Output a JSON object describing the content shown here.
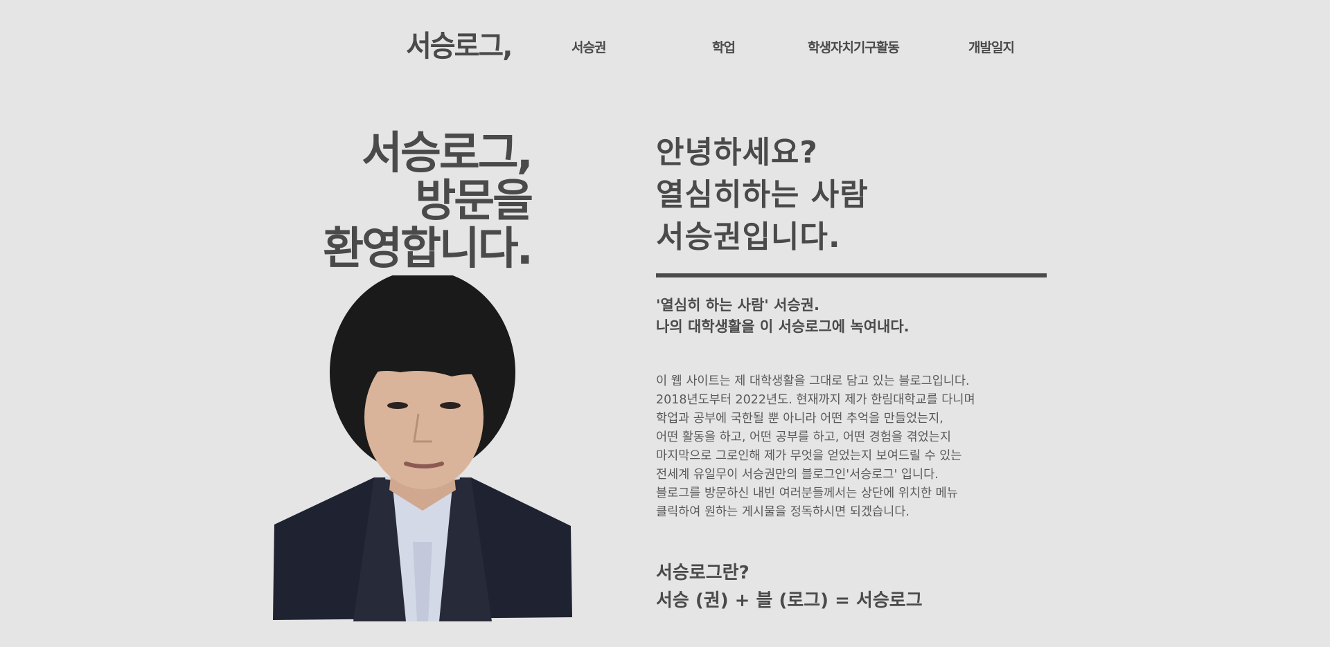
{
  "nav": {
    "logo": "서승로그,",
    "items": [
      {
        "label": "서승권"
      },
      {
        "label": "학업"
      },
      {
        "label": "학생자치기구활동"
      },
      {
        "label": "개발일지"
      }
    ]
  },
  "hero": {
    "lines": [
      "서승로그,",
      "방문을",
      "환영합니다."
    ]
  },
  "intro": {
    "greeting_lines": [
      "안녕하세요?",
      "열심히하는 사람",
      "서승권입니다."
    ],
    "subheading_lines": [
      "'열심히 하는 사람' 서승권.",
      "나의 대학생활을 이 서승로그에 녹여내다."
    ],
    "body_lines": [
      "이 웹 사이트는 제 대학생활을 그대로 담고 있는 블로그입니다.",
      "2018년도부터 2022년도. 현재까지 제가 한림대학교를 다니며",
      "학업과 공부에 국한될 뿐 아니라 어떤 추억을 만들었는지,",
      "어떤 활동을 하고, 어떤 공부를 하고, 어떤 경험을 겪었는지",
      "마지막으로 그로인해 제가 무엇을 얻었는지 보여드릴 수 있는",
      "전세계 유일무이 서승권만의 블로그인'서승로그' 입니다.",
      "블로그를 방문하신 내빈 여러분들께서는 상단에 위치한 메뉴",
      "클릭하여 원하는 게시물을 정독하시면 되겠습니다."
    ],
    "definition_lines": [
      "서승로그란?",
      "서승 (권) + 블 (로그) = 서승로그"
    ]
  },
  "colors": {
    "background": "#e5e5e5",
    "text": "#4a4a4a",
    "jacket": "#1f2230",
    "hair": "#1a1a1a",
    "skin": "#d9b49a",
    "shirt": "#d4d9e8"
  }
}
